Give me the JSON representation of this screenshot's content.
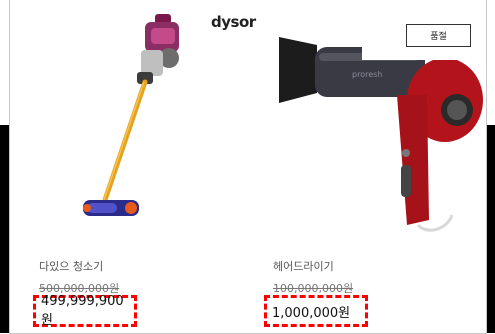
{
  "brand": {
    "logo_text": "dysor"
  },
  "products": [
    {
      "image": "stick-vacuum-image",
      "name": "다있으 청소기",
      "original_price": "500,000,000원",
      "sale_price": "499,999,900원"
    },
    {
      "image": "hair-dryer-image",
      "name": "헤어드라이기",
      "original_price": "100,000,000원",
      "sale_price": "1,000,000원",
      "badge": "품절"
    }
  ],
  "colors": {
    "highlight": "#ff0000",
    "dryer": "#b3141c",
    "vacuum_accent": "#e6a21a"
  }
}
